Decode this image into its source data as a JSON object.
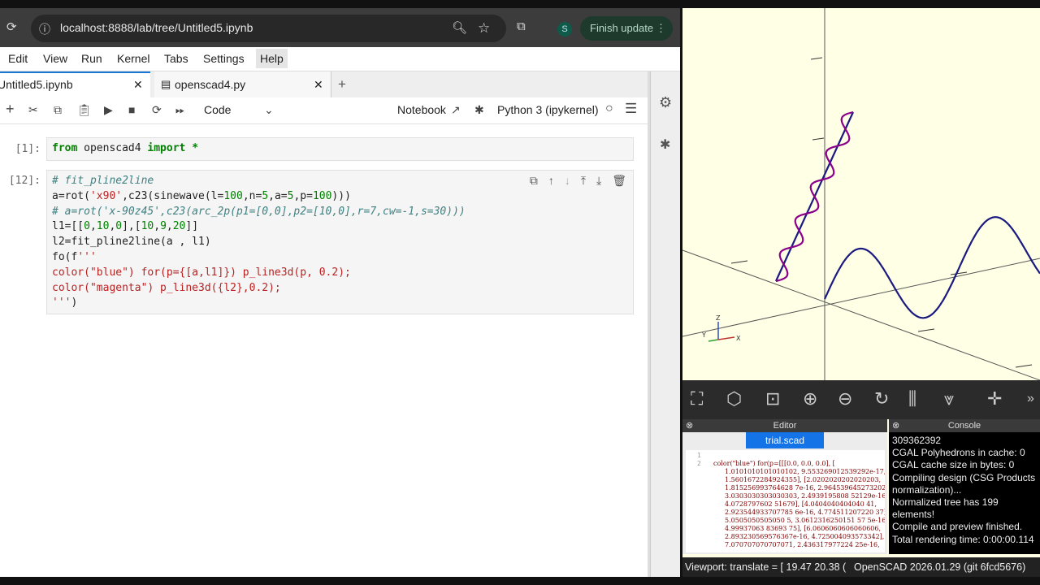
{
  "browser": {
    "url": "localhost:8888/lab/tree/Untitled5.ipynb",
    "profile_initial": "S",
    "finish_update_label": "Finish update"
  },
  "menubar": [
    "Edit",
    "View",
    "Run",
    "Kernel",
    "Tabs",
    "Settings",
    "Help"
  ],
  "tabs": [
    {
      "label": "Untitled5.ipynb"
    },
    {
      "label": "openscad4.py"
    }
  ],
  "toolbar": {
    "cell_type": "Code",
    "notebook_label": "Notebook",
    "kernel_label": "Python 3 (ipykernel)"
  },
  "cells": [
    {
      "prompt": "[1]:",
      "lines": [
        "from openscad4 import *"
      ]
    },
    {
      "prompt": "[12]:",
      "lines": [
        "# fit_pline2line",
        "a=rot('x90',c23(sinewave(l=100,n=5,a=5,p=100)))",
        "# a=rot('x-90z45',c23(arc_2p(p1=[0,0],p2=[10,0],r=7,cw=-1,s=30)))",
        "l1=[[0,10,0],[10,9,20]]",
        "l2=fit_pline2line(a , l1)",
        "fo(f'''",
        "color(\"blue\") for(p={[a,l1]}) p_line3d(p, 0.2);",
        "color(\"magenta\") p_line3d({l2},0.2);",
        "''')"
      ]
    }
  ],
  "openscad": {
    "editor_title": "Editor",
    "console_title": "Console",
    "file_tab": "trial.scad",
    "editor_line_numbers": [
      "1",
      "2"
    ],
    "editor_lines": [
      "color(\"blue\") for(p=[[[0.0, 0.0, 0.0], [",
      "1.0101010101010102, 9.553269012539292e-17,",
      "1.5601672284924355], [2.0202020202020203,",
      "1.815256993764628 7e-16, 2.964539645273202 7], [",
      "3.0303030303030303, 2.4939195808 52129e-16,",
      "4.0728797602 51679], [4.0404040404040 41,",
      "2.923544933707785 6e-16, 4.774511207220 37], [",
      "5.0505050505050 5, 3.0612316250151 57 5e-16,",
      "4.99937063 83693 75], [6.0606060606060606,",
      "2.893230569576367e-16, 4.725004093573342], [",
      "7.070707070707071, 2.436317977224 25e-16,"
    ],
    "console_lines": [
      "309362392",
      "CGAL Polyhedrons in cache: 0",
      "CGAL cache size in bytes: 0",
      "Compiling design (CSG Products normalization)...",
      "Normalized tree has 199 elements!",
      "Compile and preview finished.",
      "Total rendering time: 0:00:00.114"
    ],
    "status_viewport": "Viewport: translate = [ 19.47 20.38 (",
    "status_version": "OpenSCAD 2026.01.29 (git 6fcd5676)",
    "axis_labels": {
      "z": "Z",
      "y": "Y",
      "x": "X"
    }
  },
  "colors": {
    "blue_curve": "#1a1a80",
    "magenta_curve": "#8b008b",
    "view_bg": "#ffffe6"
  }
}
